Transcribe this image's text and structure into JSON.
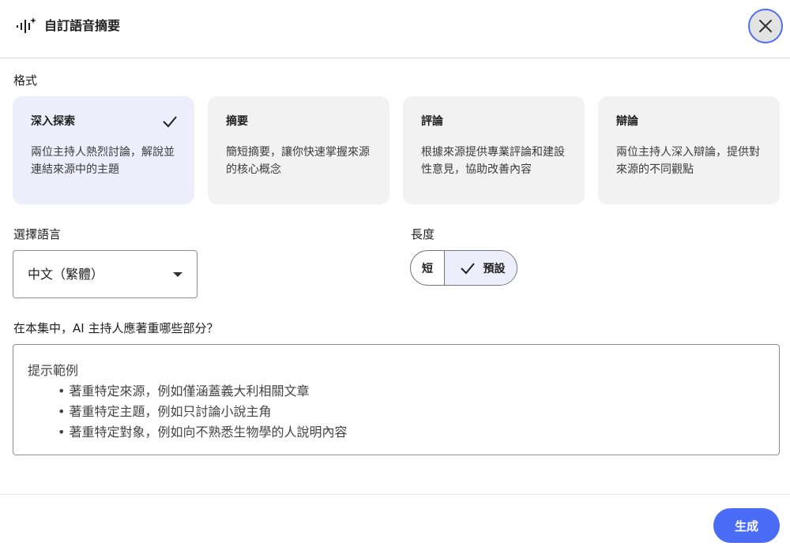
{
  "dialog": {
    "title": "自訂語音摘要",
    "header_icon": "audio-sparkle-icon",
    "close_icon": "close-icon"
  },
  "format": {
    "label": "格式",
    "cards": [
      {
        "title": "深入探索",
        "desc": "兩位主持人熱烈討論，解說並連結來源中的主題",
        "selected": true
      },
      {
        "title": "摘要",
        "desc": "簡短摘要，讓你快速掌握來源的核心概念",
        "selected": false
      },
      {
        "title": "評論",
        "desc": "根據來源提供專業評論和建設性意見，協助改善內容",
        "selected": false
      },
      {
        "title": "辯論",
        "desc": "兩位主持人深入辯論，提供對來源的不同觀點",
        "selected": false
      }
    ]
  },
  "language": {
    "label": "選擇語言",
    "value": "中文（繁體）"
  },
  "length": {
    "label": "長度",
    "options": [
      "短",
      "預設"
    ],
    "selected": "預設"
  },
  "prompt": {
    "label": "在本集中，AI 主持人應著重哪些部分？",
    "placeholder_head": "提示範例",
    "placeholder_items": [
      "著重特定來源，例如僅涵蓋義大利相關文章",
      "著重特定主題，例如只討論小說主角",
      "著重特定對象，例如向不熟悉生物學的人說明內容"
    ]
  },
  "footer": {
    "generate_label": "生成"
  },
  "colors": {
    "accent": "#4a6cf7",
    "selected_card_bg": "#eceefb",
    "card_bg": "#f2f2f2"
  }
}
